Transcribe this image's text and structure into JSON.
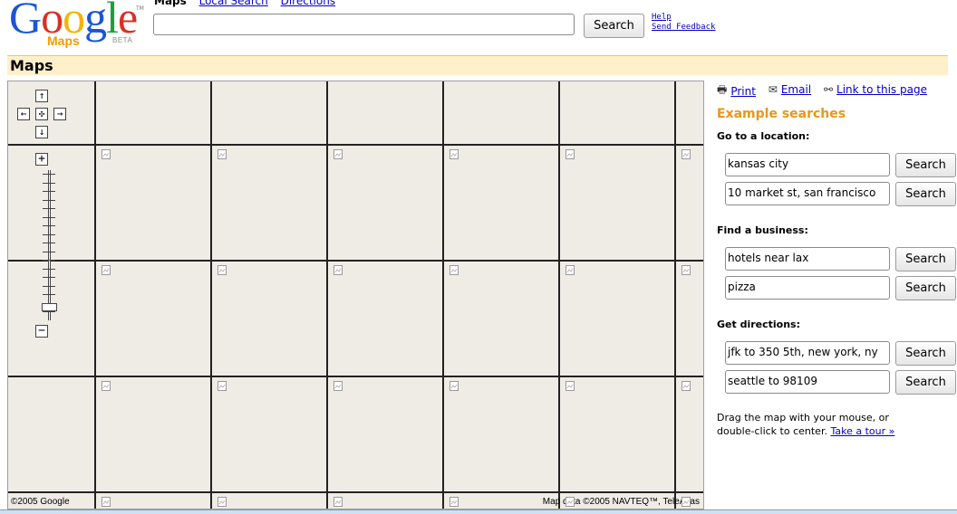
{
  "logo": {
    "text": "Google",
    "letters": [
      "G",
      "o",
      "o",
      "g",
      "l",
      "e"
    ],
    "letter_colors": [
      "#1a55d6",
      "#d93025",
      "#f4b400",
      "#1a55d6",
      "#1e9e3a",
      "#d93025"
    ],
    "product": "Maps",
    "beta": "BETA",
    "tm": "TM"
  },
  "topnav": {
    "current": "Maps",
    "local_search": "Local Search",
    "directions": "Directions"
  },
  "search": {
    "value": "",
    "button": "Search"
  },
  "help": {
    "help": "Help",
    "feedback": "Send Feedback"
  },
  "header": {
    "title": "Maps"
  },
  "map": {
    "pan_up": "↑",
    "pan_left": "←",
    "pan_center": "✣",
    "pan_right": "→",
    "pan_down": "↓",
    "zoom_in": "+",
    "zoom_out": "−",
    "copyright_left": "©2005 Google",
    "copyright_right": "Map data ©2005 NAVTEQ™, TeleAtlas"
  },
  "side": {
    "print": "Print",
    "email": "Email",
    "link": "Link to this page",
    "example_title": "Example searches",
    "location": {
      "title": "Go to a location:",
      "q1": "kansas city",
      "q2": "10 market st, san francisco"
    },
    "business": {
      "title": "Find a business:",
      "q1": "hotels near lax",
      "q2": "pizza"
    },
    "directions": {
      "title": "Get directions:",
      "q1": "jfk to 350 5th, new york, ny",
      "q2": "seattle to 98109"
    },
    "button": "Search",
    "hint": "Drag the map with your mouse, or double-click to center.",
    "tour": "Take a tour »"
  },
  "colors": {
    "header_bg": "#fff0cc",
    "link": "#0000cc",
    "example_title": "#e8961c",
    "map_bg": "#efece6"
  }
}
